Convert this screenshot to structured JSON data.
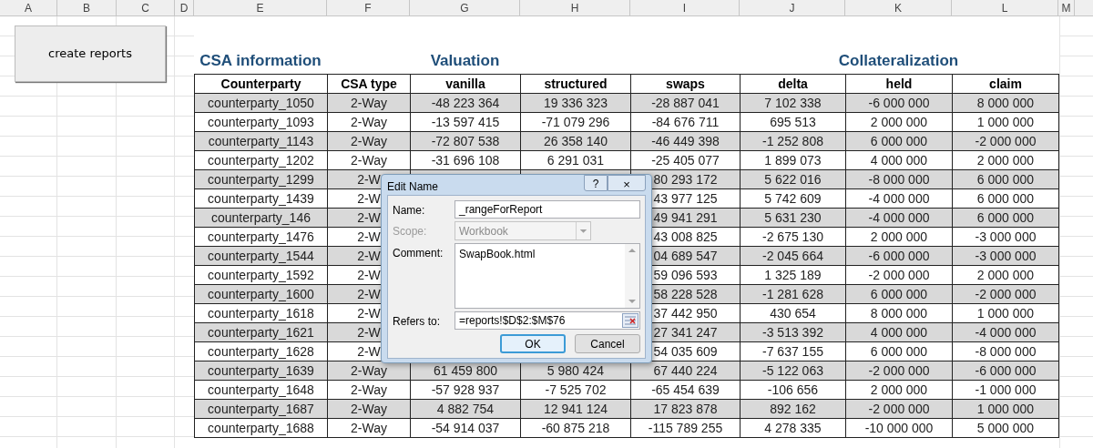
{
  "sheet": {
    "column_headers": [
      "A",
      "B",
      "C",
      "D",
      "E",
      "F",
      "G",
      "H",
      "I",
      "J",
      "K",
      "L",
      "M"
    ],
    "macro_button": {
      "label": "create reports"
    },
    "section_titles": [
      "CSA information",
      "Valuation",
      "Collateralization"
    ],
    "table": {
      "columns": [
        "Counterparty",
        "CSA type",
        "vanilla",
        "structured",
        "swaps",
        "delta",
        "held",
        "claim"
      ],
      "rows": [
        {
          "cells": [
            "counterparty_1050",
            "2-Way",
            "-48 223 364",
            "19 336 323",
            "-28 887 041",
            "7 102 338",
            "-6 000 000",
            "8 000 000"
          ]
        },
        {
          "cells": [
            "counterparty_1093",
            "2-Way",
            "-13 597 415",
            "-71 079 296",
            "-84 676 711",
            "695 513",
            "2 000 000",
            "1 000 000"
          ]
        },
        {
          "cells": [
            "counterparty_1143",
            "2-Way",
            "-72 807 538",
            "26 358 140",
            "-46 449 398",
            "-1 252 808",
            "6 000 000",
            "-2 000 000"
          ]
        },
        {
          "cells": [
            "counterparty_1202",
            "2-Way",
            "-31 696 108",
            "6 291 031",
            "-25 405 077",
            "1 899 073",
            "4 000 000",
            "2 000 000"
          ]
        },
        {
          "cells": [
            "counterparty_1299",
            "2-W",
            null,
            null,
            "80 293 172",
            "5 622 016",
            "-8 000 000",
            "6 000 000"
          ]
        },
        {
          "cells": [
            "counterparty_1439",
            "2-W",
            null,
            null,
            "43 977 125",
            "5 742 609",
            "-4 000 000",
            "6 000 000"
          ]
        },
        {
          "cells": [
            "counterparty_146",
            "2-W",
            null,
            null,
            "49 941 291",
            "5 631 230",
            "-4 000 000",
            "6 000 000"
          ]
        },
        {
          "cells": [
            "counterparty_1476",
            "2-W",
            null,
            null,
            "43 008 825",
            "-2 675 130",
            "2 000 000",
            "-3 000 000"
          ]
        },
        {
          "cells": [
            "counterparty_1544",
            "2-W",
            null,
            null,
            "04 689 547",
            "-2 045 664",
            "-6 000 000",
            "-3 000 000"
          ]
        },
        {
          "cells": [
            "counterparty_1592",
            "2-W",
            null,
            null,
            "59 096 593",
            "1 325 189",
            "-2 000 000",
            "2 000 000"
          ]
        },
        {
          "cells": [
            "counterparty_1600",
            "2-W",
            null,
            null,
            "58 228 528",
            "-1 281 628",
            "6 000 000",
            "-2 000 000"
          ]
        },
        {
          "cells": [
            "counterparty_1618",
            "2-W",
            null,
            null,
            "37 442 950",
            "430 654",
            "8 000 000",
            "1 000 000"
          ]
        },
        {
          "cells": [
            "counterparty_1621",
            "2-W",
            null,
            null,
            "27 341 247",
            "-3 513 392",
            "4 000 000",
            "-4 000 000"
          ]
        },
        {
          "cells": [
            "counterparty_1628",
            "2-W",
            null,
            null,
            "54 035 609",
            "-7 637 155",
            "6 000 000",
            "-8 000 000"
          ]
        },
        {
          "cells": [
            "counterparty_1639",
            "2-Way",
            "61 459 800",
            "5 980 424",
            "67 440 224",
            "-5 122 063",
            "-2 000 000",
            "-6 000 000"
          ]
        },
        {
          "cells": [
            "counterparty_1648",
            "2-Way",
            "-57 928 937",
            "-7 525 702",
            "-65 454 639",
            "-106 656",
            "2 000 000",
            "-1 000 000"
          ]
        },
        {
          "cells": [
            "counterparty_1687",
            "2-Way",
            "4 882 754",
            "12 941 124",
            "17 823 878",
            "892 162",
            "-2 000 000",
            "1 000 000"
          ]
        },
        {
          "cells": [
            "counterparty_1688",
            "2-Way",
            "-54 914 037",
            "-60 875 218",
            "-115 789 255",
            "4 278 335",
            "-10 000 000",
            "5 000 000"
          ]
        }
      ]
    }
  },
  "dialog": {
    "title": "Edit Name",
    "help_button": "?",
    "close_button": "×",
    "fields": [
      {
        "kind": "text",
        "label": "Name:",
        "value": "_rangeForReport",
        "disabled": false
      },
      {
        "kind": "select",
        "label": "Scope:",
        "value": "Workbook",
        "disabled": true
      },
      {
        "kind": "textarea",
        "label": "Comment:",
        "value": "SwapBook.html",
        "disabled": false
      },
      {
        "kind": "range",
        "label": "Refers to:",
        "value": "=reports!$D$2:$M$76",
        "disabled": false
      }
    ],
    "buttons": [
      {
        "label": "OK",
        "default": true
      },
      {
        "label": "Cancel",
        "default": false
      }
    ]
  }
}
